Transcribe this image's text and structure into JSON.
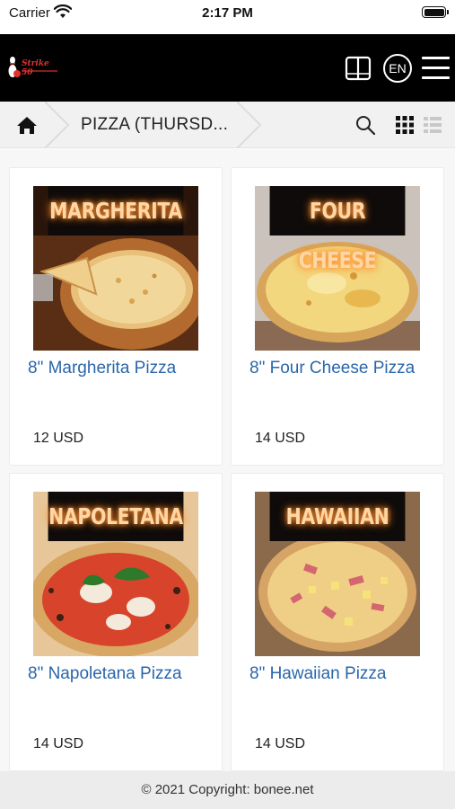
{
  "status_bar": {
    "carrier": "Carrier",
    "time": "2:17 PM"
  },
  "header": {
    "logo_text": "Strike 50",
    "language": "EN"
  },
  "breadcrumb": {
    "title": "PIZZA (THURSD..."
  },
  "products": [
    {
      "banner": "MARGHERITA",
      "name": "8\" Margherita Pizza",
      "price": "12 USD",
      "image": "margherita-pizza"
    },
    {
      "banner": "FOUR CHEESE",
      "name": "8\" Four Cheese Pizza",
      "price": "14 USD",
      "image": "four-cheese-pizza"
    },
    {
      "banner": "NAPOLETANA",
      "name": "8\" Napoletana Pizza",
      "price": "14 USD",
      "image": "napoletana-pizza"
    },
    {
      "banner": "HAWAIIAN",
      "name": "8\" Hawaiian Pizza",
      "price": "14 USD",
      "image": "hawaiian-pizza"
    }
  ],
  "footer": {
    "copyright": "© 2021 Copyright: bonee.net"
  },
  "colors": {
    "header_bg": "#000000",
    "link": "#2a66aa",
    "breadcrumb_bg": "#f1f1f1",
    "footer_bg": "#ececec"
  }
}
